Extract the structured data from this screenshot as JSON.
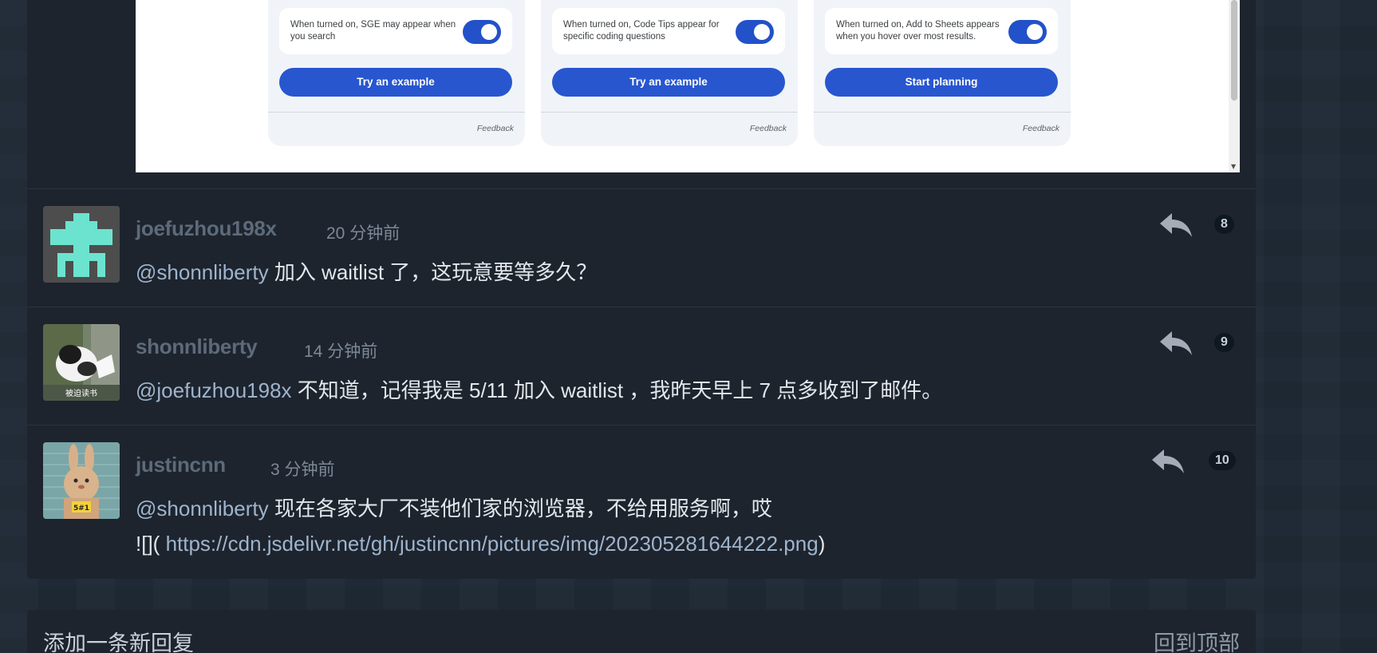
{
  "embed": {
    "cards": [
      {
        "toggle_text": "When turned on, SGE may appear when you search",
        "button": "Try an example",
        "feedback": "Feedback"
      },
      {
        "toggle_text": "When turned on, Code Tips appear for specific coding questions",
        "button": "Try an example",
        "feedback": "Feedback"
      },
      {
        "toggle_text": "When turned on, Add to Sheets appears when you hover over most results.",
        "button": "Start planning",
        "feedback": "Feedback"
      }
    ]
  },
  "replies": [
    {
      "username": "joefuzhou198x",
      "time_ago": "20 分钟前",
      "floor": "8",
      "mention": "@shonnliberty",
      "text": " 加入 waitlist 了，这玩意要等多久？"
    },
    {
      "username": "shonnliberty",
      "time_ago": "14 分钟前",
      "floor": "9",
      "mention": "@joefuzhou198x",
      "text": " 不知道，记得我是 5/11 加入 waitlist ，我昨天早上 7 点多收到了邮件。",
      "avatar_caption": "被迫读书"
    },
    {
      "username": "justincnn",
      "time_ago": "3 分钟前",
      "floor": "10",
      "mention": "@shonnliberty",
      "text": " 现在各家大厂不装他们家的浏览器，不给用服务啊，哎",
      "line2_prefix": "![](",
      "line2_link": " https://cdn.jsdelivr.net/gh/justincnn/pictures/img/202305281644222.png",
      "line2_suffix": ")",
      "avatar_caption": "5#1"
    }
  ],
  "footer": {
    "add_reply": "添加一条新回复",
    "back_to_top": "回到顶部"
  },
  "colors": {
    "page_bg": "#1f2a36",
    "box_bg": "#1d242e",
    "toggle_on": "#2251c9",
    "button_blue": "#2756cf",
    "mention": "#9fb4cc"
  },
  "icons": [
    "reply-arrow-icon",
    "toggle-switch"
  ]
}
